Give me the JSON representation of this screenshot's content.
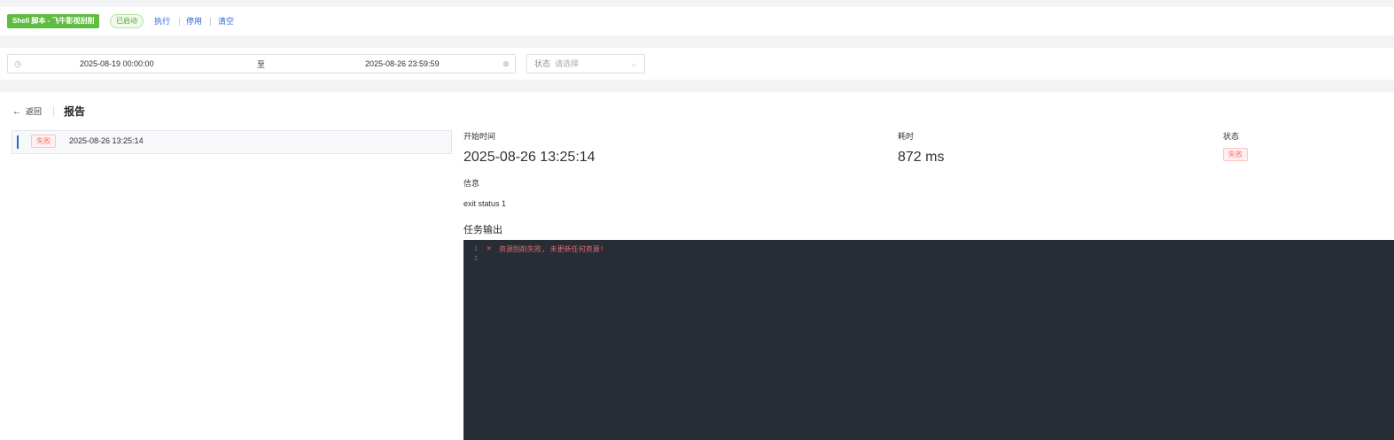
{
  "top_bar": {
    "task_tag": "Shell 脚本 - 飞牛影视刮削",
    "state_tag": "已启动",
    "actions": {
      "run": "执行",
      "disable": "停用",
      "clear": "清空"
    }
  },
  "filter": {
    "start_date": "2025-08-19 00:00:00",
    "range_separator": "至",
    "end_date": "2025-08-26 23:59:59",
    "status_label": "状态",
    "status_placeholder": "请选择"
  },
  "report": {
    "back_label": "返回",
    "title": "报告",
    "runs": [
      {
        "status": "失败",
        "time": "2025-08-26 13:25:14"
      }
    ],
    "detail": {
      "start_time_label": "开始时间",
      "start_time": "2025-08-26 13:25:14",
      "duration_label": "耗时",
      "duration": "872 ms",
      "status_label": "状态",
      "status": "失败",
      "info_label": "信息",
      "info": "exit status 1",
      "output_label": "任务输出"
    },
    "console": {
      "lines": [
        {
          "num": "1",
          "icon": "✕",
          "text": "资源刮削失败, 未更新任何资源!"
        },
        {
          "num": "2",
          "icon": "",
          "text": ""
        }
      ]
    }
  },
  "colors": {
    "primary": "#2468d6",
    "success_tag": "#5ebd3f",
    "danger": "#f56c6c",
    "console_bg": "#282c34"
  }
}
